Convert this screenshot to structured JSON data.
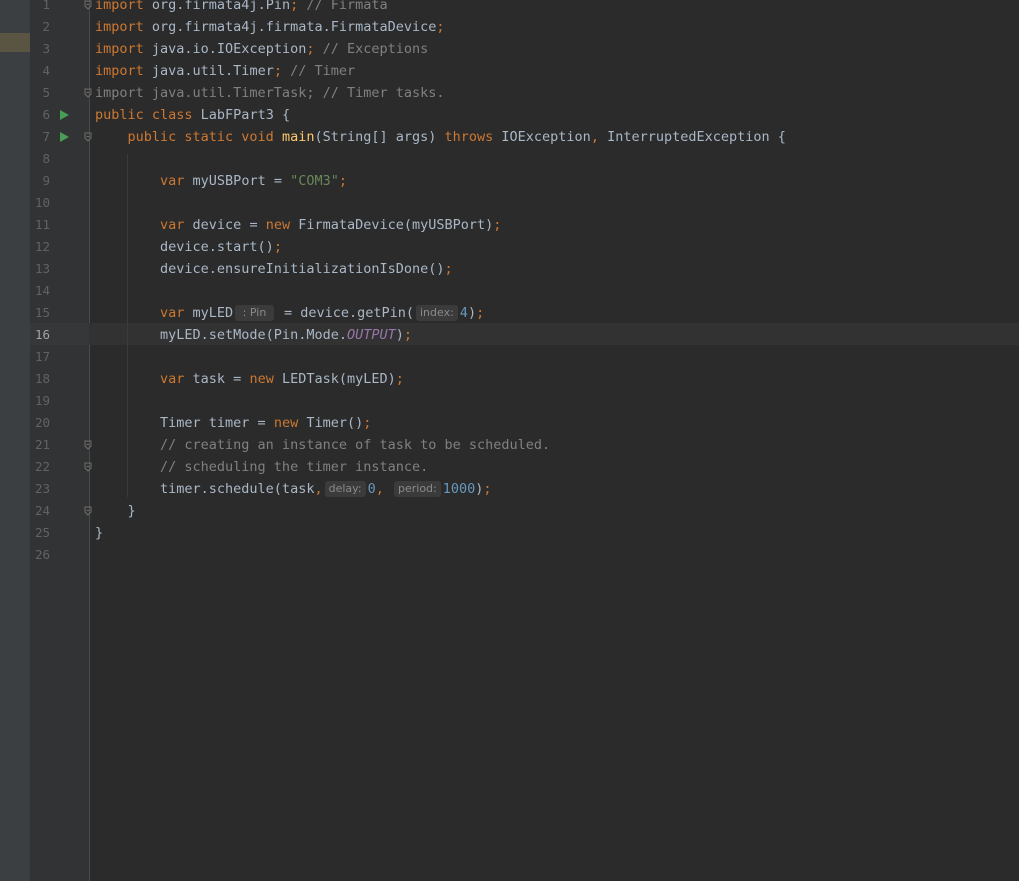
{
  "editor": {
    "current_line": "16",
    "lines": [
      {
        "num": "1",
        "parts": [
          {
            "t": "import ",
            "c": "kw"
          },
          {
            "t": "org.firmata4j.Pin",
            "c": "p"
          },
          {
            "t": "; ",
            "c": "kw"
          },
          {
            "t": "// Firmata",
            "c": "cmt"
          }
        ]
      },
      {
        "num": "2",
        "parts": [
          {
            "t": "import ",
            "c": "kw"
          },
          {
            "t": "org.firmata4j.firmata.FirmataDevice",
            "c": "p"
          },
          {
            "t": ";",
            "c": "kw"
          }
        ]
      },
      {
        "num": "3",
        "parts": [
          {
            "t": "import ",
            "c": "kw"
          },
          {
            "t": "java.io.IOException",
            "c": "p"
          },
          {
            "t": "; ",
            "c": "kw"
          },
          {
            "t": "// Exceptions",
            "c": "cmt"
          }
        ]
      },
      {
        "num": "4",
        "parts": [
          {
            "t": "import ",
            "c": "kw"
          },
          {
            "t": "java.util.Timer",
            "c": "p"
          },
          {
            "t": "; ",
            "c": "kw"
          },
          {
            "t": "// Timer",
            "c": "cmt"
          }
        ]
      },
      {
        "num": "5",
        "parts": [
          {
            "t": "import java.util.TimerTask; ",
            "c": "gray"
          },
          {
            "t": "// Timer tasks.",
            "c": "cmt"
          }
        ]
      },
      {
        "num": "6",
        "parts": [
          {
            "t": "public class ",
            "c": "kw"
          },
          {
            "t": "LabFPart3 {",
            "c": "p"
          }
        ]
      },
      {
        "num": "7",
        "parts": [
          {
            "t": "    public static void ",
            "c": "kw"
          },
          {
            "t": "main",
            "c": "fn"
          },
          {
            "t": "(String[] args) ",
            "c": "p"
          },
          {
            "t": "throws ",
            "c": "kw"
          },
          {
            "t": "IOException",
            "c": "p"
          },
          {
            "t": ", ",
            "c": "kw"
          },
          {
            "t": "InterruptedException {",
            "c": "p"
          }
        ]
      },
      {
        "num": "8",
        "parts": []
      },
      {
        "num": "9",
        "parts": [
          {
            "t": "        var ",
            "c": "kw"
          },
          {
            "t": "myUSBPort = ",
            "c": "p"
          },
          {
            "t": "\"COM3\"",
            "c": "str"
          },
          {
            "t": ";",
            "c": "kw"
          }
        ]
      },
      {
        "num": "10",
        "parts": []
      },
      {
        "num": "11",
        "parts": [
          {
            "t": "        var ",
            "c": "kw"
          },
          {
            "t": "device = ",
            "c": "p"
          },
          {
            "t": "new ",
            "c": "kw"
          },
          {
            "t": "FirmataDevice(myUSBPort)",
            "c": "p"
          },
          {
            "t": ";",
            "c": "kw"
          }
        ]
      },
      {
        "num": "12",
        "parts": [
          {
            "t": "        device.start()",
            "c": "p"
          },
          {
            "t": ";",
            "c": "kw"
          }
        ]
      },
      {
        "num": "13",
        "parts": [
          {
            "t": "        device.ensureInitializationIsDone()",
            "c": "p"
          },
          {
            "t": ";",
            "c": "kw"
          }
        ]
      },
      {
        "num": "14",
        "parts": []
      },
      {
        "num": "15",
        "parts": [
          {
            "t": "        var ",
            "c": "kw"
          },
          {
            "t": "myLED",
            "c": "p"
          },
          {
            "t": " : Pin ",
            "c": "hint"
          },
          {
            "t": " = device.getPin(",
            "c": "p"
          },
          {
            "t": "index:",
            "c": "hint"
          },
          {
            "t": "4",
            "c": "num"
          },
          {
            "t": ")",
            "c": "p"
          },
          {
            "t": ";",
            "c": "kw"
          }
        ]
      },
      {
        "num": "16",
        "parts": [
          {
            "t": "        myLED.setMode(Pin.Mode.",
            "c": "p"
          },
          {
            "t": "OUTPUT",
            "c": "const"
          },
          {
            "t": ")",
            "c": "p"
          },
          {
            "t": ";",
            "c": "kw"
          }
        ]
      },
      {
        "num": "17",
        "parts": []
      },
      {
        "num": "18",
        "parts": [
          {
            "t": "        var ",
            "c": "kw"
          },
          {
            "t": "task = ",
            "c": "p"
          },
          {
            "t": "new ",
            "c": "kw"
          },
          {
            "t": "LEDTask(myLED)",
            "c": "p"
          },
          {
            "t": ";",
            "c": "kw"
          }
        ]
      },
      {
        "num": "19",
        "parts": []
      },
      {
        "num": "20",
        "parts": [
          {
            "t": "        Timer timer = ",
            "c": "p"
          },
          {
            "t": "new ",
            "c": "kw"
          },
          {
            "t": "Timer()",
            "c": "p"
          },
          {
            "t": ";",
            "c": "kw"
          }
        ]
      },
      {
        "num": "21",
        "parts": [
          {
            "t": "        // creating an instance of task to be scheduled.",
            "c": "cmt"
          }
        ]
      },
      {
        "num": "22",
        "parts": [
          {
            "t": "        // scheduling the timer instance.",
            "c": "cmt"
          }
        ]
      },
      {
        "num": "23",
        "parts": [
          {
            "t": "        timer.schedule(task",
            "c": "p"
          },
          {
            "t": ",",
            "c": "kw"
          },
          {
            "t": "delay:",
            "c": "hint"
          },
          {
            "t": "0",
            "c": "num"
          },
          {
            "t": ",",
            "c": "kw"
          },
          {
            "t": " ",
            "c": "p"
          },
          {
            "t": "period:",
            "c": "hint"
          },
          {
            "t": "1000",
            "c": "num"
          },
          {
            "t": ")",
            "c": "p"
          },
          {
            "t": ";",
            "c": "kw"
          }
        ]
      },
      {
        "num": "24",
        "parts": [
          {
            "t": "    }",
            "c": "p"
          }
        ]
      },
      {
        "num": "25",
        "parts": [
          {
            "t": "}",
            "c": "p"
          }
        ]
      },
      {
        "num": "26",
        "parts": []
      }
    ],
    "run_icon_lines": [
      6,
      7
    ],
    "fold_icon_lines": [
      1,
      5,
      7,
      21,
      22,
      24
    ],
    "colors": {
      "background": "#2b2b2b",
      "keyword": "#cc7832",
      "string": "#6a8759",
      "number": "#6897bb",
      "comment": "#808080",
      "method": "#ffc66d",
      "constant": "#9876aa",
      "plain": "#a9b7c6",
      "run_icon": "#499c54"
    }
  }
}
